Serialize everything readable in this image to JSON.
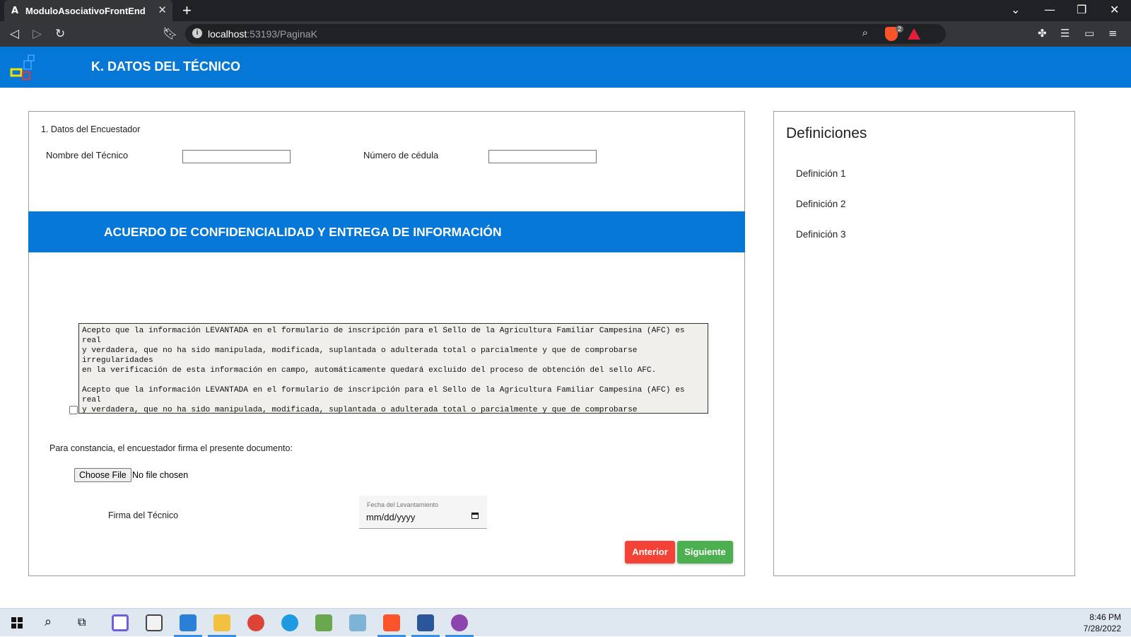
{
  "browser": {
    "tab_title": "ModuloAsociativoFrontEnd",
    "tab_favicon": "A",
    "url_host": "localhost",
    "url_path": ":53193/PaginaK",
    "shields_count": "2"
  },
  "header": {
    "title": "K. DATOS DEL TÉCNICO"
  },
  "form": {
    "section_title": "1. Datos del Encuestador",
    "tech_name_label": "Nombre del Técnico",
    "tech_name_value": "",
    "id_label": "Número de cédula",
    "id_value": "",
    "band_title": "ACUERDO DE CONFIDENCIALIDAD Y ENTREGA DE INFORMACIÓN",
    "agreement_text": "Acepto que la información LEVANTADA en el formulario de inscripción para el Sello de la Agricultura Familiar Campesina (AFC) es real\ny verdadera, que no ha sido manipulada, modificada, suplantada o adulterada total o parcialmente y que de comprobarse irregularidades\nen la verificación de esta información en campo, automáticamente quedará excluido del proceso de obtención del sello AFC.\n\nAcepto que la información LEVANTADA en el formulario de inscripción para el Sello de la Agricultura Familiar Campesina (AFC) es real\ny verdadera, que no ha sido manipulada, modificada, suplantada o adulterada total o parcialmente y que de comprobarse",
    "agreement_checked": false,
    "signature_prompt": "Para constancia, el encuestador firma el presente documento:",
    "file_button": "Choose File",
    "file_status": "No file chosen",
    "signature_label": "Firma del Técnico",
    "date_caption": "Fecha del Levantamiento",
    "date_placeholder": "mm/dd/yyyy",
    "prev_button": "Anterior",
    "next_button": "Siguiente"
  },
  "definitions": {
    "title": "Definiciones",
    "items": [
      "Definición 1",
      "Definición 2",
      "Definición 3"
    ]
  },
  "taskbar": {
    "time": "8:46 PM",
    "date": "7/28/2022"
  },
  "colors": {
    "brand_blue": "#0477d7",
    "prev_red": "#f44336",
    "next_green": "#4caf50"
  }
}
